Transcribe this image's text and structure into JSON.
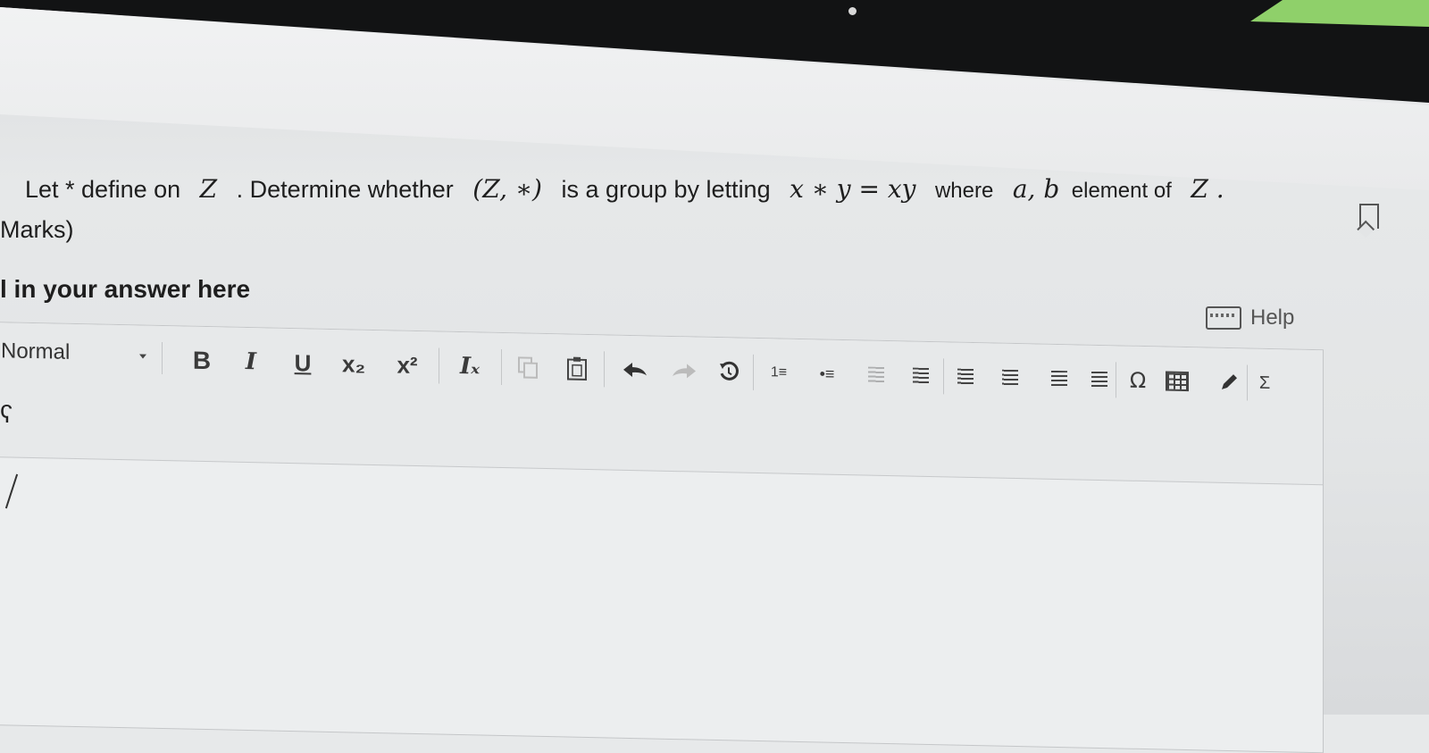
{
  "question": {
    "part1": "Let * define on",
    "set_symbol": "Z",
    "part2": ". Determine whether",
    "pair": "(Z, ∗)",
    "part3": "is a group by letting",
    "operation": "x ∗ y = xy",
    "part4": "where",
    "elements": "a, b",
    "part5": "element of",
    "set_symbol_end": "Z .",
    "marks_suffix": "Marks)"
  },
  "answer": {
    "label": "l in your answer here",
    "help_label": "Help"
  },
  "toolbar": {
    "format_select": "Normal",
    "bold": "B",
    "italic": "I",
    "underline": "U",
    "subscript": "x₂",
    "superscript": "x²",
    "clear_format": "Iₓ",
    "special_char": "Ω",
    "sum": "Σ",
    "ordered_list": "1≡",
    "bullet_list": "•≡"
  },
  "editor_side_marker": "ʕ"
}
